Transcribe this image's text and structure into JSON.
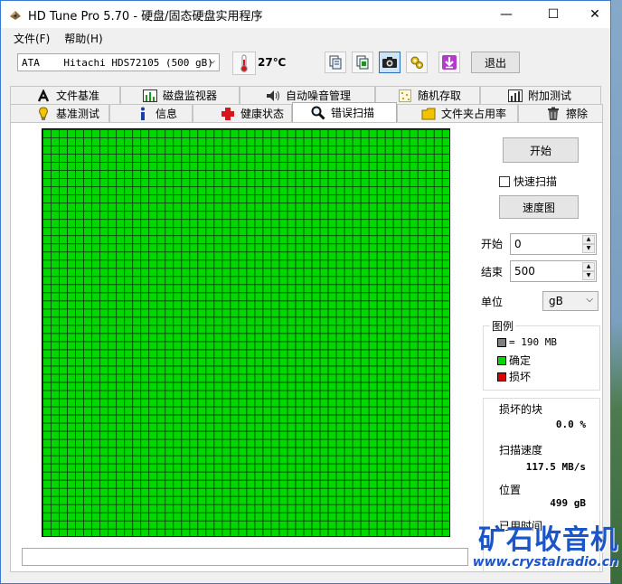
{
  "window": {
    "title": "HD Tune Pro 5.70 - 硬盘/固态硬盘实用程序",
    "min_glyph": "—",
    "max_glyph": "☐",
    "close_glyph": "✕"
  },
  "menu": [
    "文件(F)",
    "帮助(H)"
  ],
  "toolbar": {
    "drive": "ATA    Hitachi HDS72105 (500 gB)",
    "temperature": "27℃",
    "buttons": [
      {
        "icon": "copy-text-icon"
      },
      {
        "icon": "copy-info-icon"
      },
      {
        "icon": "camera-icon"
      },
      {
        "icon": "settings-icon"
      },
      {
        "icon": "save-download-icon"
      }
    ],
    "exit_label": "退出"
  },
  "tabs_top": [
    {
      "label": "文件基准",
      "icon": "file-benchmark-icon"
    },
    {
      "label": "磁盘监视器",
      "icon": "disk-monitor-icon"
    },
    {
      "label": "自动噪音管理",
      "icon": "speaker-icon"
    },
    {
      "label": "随机存取",
      "icon": "random-access-icon"
    },
    {
      "label": "附加测试",
      "icon": "extra-tests-icon"
    }
  ],
  "tabs_bottom": [
    {
      "label": "基准测试",
      "icon": "benchmark-icon"
    },
    {
      "label": "信息",
      "icon": "info-icon"
    },
    {
      "label": "健康状态",
      "icon": "health-cross-icon"
    },
    {
      "label": "错误扫描",
      "icon": "magnifier-icon",
      "selected": true
    },
    {
      "label": "文件夹占用率",
      "icon": "folder-icon"
    },
    {
      "label": "擦除",
      "icon": "trash-icon"
    }
  ],
  "scan": {
    "start_label": "开始",
    "quick_scan_label": "快速扫描",
    "quick_scan_checked": false,
    "speed_map_label": "速度图",
    "start_field_label": "开始",
    "start_value": "0",
    "end_field_label": "结束",
    "end_value": "500",
    "unit_label": "单位",
    "unit_value": "gB",
    "grid_state": "all-ok"
  },
  "legend": {
    "title": "图例",
    "block_size": "= 190 MB",
    "ok_label": "确定",
    "bad_label": "损坏",
    "colors": {
      "block": "#808080",
      "ok": "#00d800",
      "bad": "#e00000"
    }
  },
  "stats": {
    "damaged_label": "损坏的块",
    "damaged_value": "0.0 %",
    "speed_label": "扫描速度",
    "speed_value": "117.5 MB/s",
    "position_label": "位置",
    "position_value": "499 gB",
    "elapsed_label": "已用时间"
  },
  "watermark": {
    "text_cn": "矿石收音机",
    "url": "www.crystalradio.cn"
  }
}
